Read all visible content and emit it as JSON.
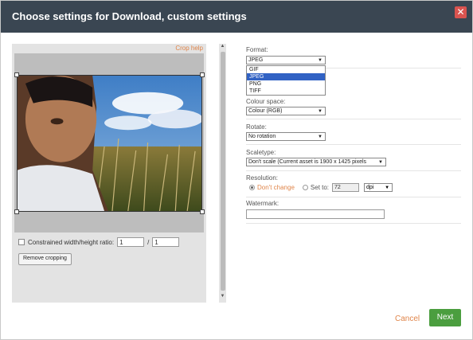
{
  "dialog": {
    "title": "Choose settings for Download, custom settings",
    "close_glyph": "✕"
  },
  "crop": {
    "help_link": "Crop help",
    "constrained_label": "Constrained width/height ratio:",
    "ratio_w": "1",
    "ratio_sep": "/",
    "ratio_h": "1",
    "remove_label": "Remove cropping"
  },
  "form": {
    "format": {
      "label": "Format:",
      "value": "JPEG",
      "options": [
        "GIF",
        "JPEG",
        "PNG",
        "TIFF"
      ]
    },
    "colour_space": {
      "label": "Colour space:",
      "value": "Colour (RGB)"
    },
    "rotate": {
      "label": "Rotate:",
      "value": "No rotation"
    },
    "scaletype": {
      "label": "Scaletype:",
      "value": "Don't scale (Current asset is 1900 x 1425 pixels"
    },
    "resolution": {
      "label": "Resolution:",
      "dont_change": "Don't change",
      "set_to": "Set to:",
      "dpi_value": "72",
      "unit": "dpi"
    },
    "watermark": {
      "label": "Watermark:",
      "value": ""
    }
  },
  "footer": {
    "cancel_label": "Cancel",
    "next_label": "Next"
  }
}
